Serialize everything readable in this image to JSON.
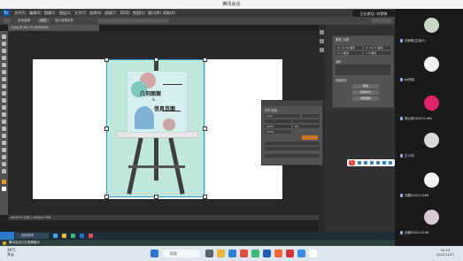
{
  "window_title": "腾讯会议",
  "sharing_status": "正在讲话: 刘伊晓",
  "ps_menu": [
    "文件(F)",
    "编辑(E)",
    "图像(I)",
    "图层(L)",
    "文字(Y)",
    "选择(S)",
    "滤镜(T)",
    "3D(D)",
    "视图(V)",
    "窗口(W)",
    "帮助(H)"
  ],
  "options_bar": {
    "auto_select": "自动选择:",
    "layer_select": "图层",
    "transform": "显示变换控件"
  },
  "document_tab": "1.jpg @ 66.7% (RGB/8#)",
  "status_bar": "66.67%  文档:1.60M/4.73M",
  "poster": {
    "title_line1": "几何图案",
    "title_line2": "信息页面"
  },
  "properties_panel": {
    "title": "属性 文档",
    "width": "W: 31.94 厘米",
    "height": "H: 21.17 厘米",
    "x": "X: 0 厘米",
    "y": "Y: 0 厘米",
    "canvas_label": "画布",
    "quick_actions": "快速操作",
    "buttons": [
      "裁剪",
      "移除背景",
      "修整图像"
    ]
  },
  "character_panel": {
    "title": "字符 段落",
    "font": "Arial",
    "fields": [
      "100%",
      "0%",
      "100%"
    ]
  },
  "ps_taskbar": {
    "document": "如何使用"
  },
  "notification": "腾讯会议已共享屏幕中",
  "participants": [
    {
      "name": "刘伊晓(主持人)",
      "avatar_color": "#c7d8c2"
    },
    {
      "name": "ps作品",
      "avatar_color": "#f2f2f2"
    },
    {
      "name": "林心妍202211166",
      "avatar_color": "#e2236b"
    },
    {
      "name": "王小刘",
      "avatar_color": "#d8d8d8"
    },
    {
      "name": "刘君202211169",
      "avatar_color": "#f0f0f0"
    },
    {
      "name": "孙鑫202211156",
      "avatar_color": "#d8c8d2"
    }
  ],
  "win_taskbar": {
    "weather_temp": "16°C",
    "weather_text": "多云",
    "search_placeholder": "搜索",
    "time": "20:19",
    "date": "2022/11/27"
  }
}
